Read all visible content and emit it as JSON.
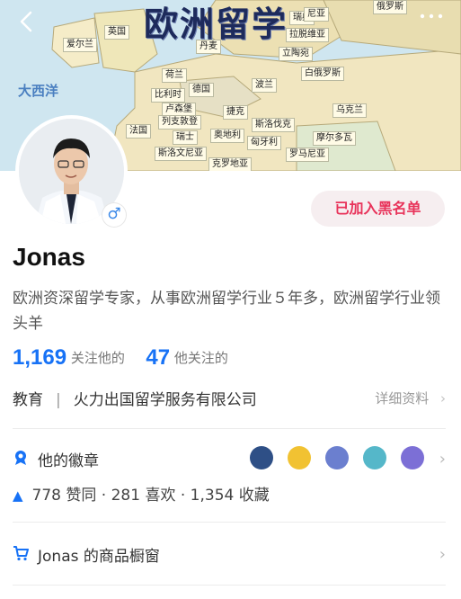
{
  "banner": {
    "title": "欧洲留学",
    "ocean": "大西洋",
    "countries": [
      "爱尔兰",
      "英国",
      "丹麦",
      "瑞典",
      "拉脱维亚",
      "立陶宛",
      "白俄罗斯",
      "荷兰",
      "比利时",
      "德国",
      "波兰",
      "卢森堡",
      "列支敦登",
      "捷克",
      "斯洛伐克",
      "乌克兰",
      "法国",
      "瑞士",
      "奥地利",
      "匈牙利",
      "摩尔多瓦",
      "斯洛文尼亚",
      "罗马尼亚",
      "克罗地亚",
      "俄罗斯",
      "尼亚"
    ]
  },
  "toolbar": {
    "back_icon": "back-arrow-icon",
    "more_icon": "more-icon"
  },
  "profile": {
    "name": "Jonas",
    "gender_symbol": "♂",
    "bio": "欧洲资深留学专家，从事欧洲留学行业５年多，欧洲留学行业领头羊",
    "blacklist_label": "已加入黑名单"
  },
  "stats": {
    "followers_count": "1,169",
    "followers_label": "关注他的",
    "following_count": "47",
    "following_label": "他关注的"
  },
  "company": {
    "industry": "教育",
    "separator": "|",
    "name": "火力出国留学服务有限公司",
    "details_label": "详细资料"
  },
  "badges": {
    "title": "他的徽章",
    "colors": [
      "#2e4f86",
      "#f1c232",
      "#6b7fcf",
      "#55b7c9",
      "#7c6fd6"
    ]
  },
  "engagement": {
    "text": "778 赞同 · 281 喜欢 · 1,354 收藏"
  },
  "shop": {
    "label": "Jonas 的商品橱窗"
  },
  "colors": {
    "accent": "#1772f6",
    "danger": "#e8335a"
  }
}
